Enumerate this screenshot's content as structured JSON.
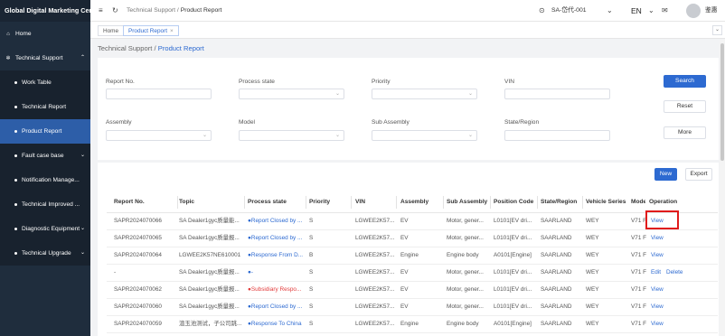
{
  "app": {
    "title": "Global Digital Marketing Center"
  },
  "sidebar": {
    "items": [
      {
        "label": "Home",
        "icon": "home-icon",
        "type": "top",
        "arrow": ""
      },
      {
        "label": "Technical Support",
        "icon": "gear-icon",
        "type": "top",
        "arrow": "⌃"
      },
      {
        "label": "Work Table",
        "type": "sub"
      },
      {
        "label": "Technical Report",
        "type": "sub"
      },
      {
        "label": "Product Report",
        "type": "sub",
        "active": true
      },
      {
        "label": "Fault case base",
        "type": "sub",
        "arrow": "⌄"
      },
      {
        "label": "Notification Manage...",
        "type": "sub"
      },
      {
        "label": "Technical Improved ...",
        "type": "sub"
      },
      {
        "label": "Diagnostic Equipment",
        "type": "sub",
        "arrow": "⌄"
      },
      {
        "label": "Technical Upgrade",
        "type": "sub",
        "arrow": "⌄"
      }
    ]
  },
  "topbar": {
    "breadcrumb": [
      "Technical Support",
      "Product Report"
    ],
    "org": "SA-岱代-001",
    "lang": "EN",
    "user": "鉴惠"
  },
  "tabs": [
    {
      "label": "Home",
      "active": false
    },
    {
      "label": "Product Report",
      "active": true
    }
  ],
  "page_breadcrumb": {
    "parent": "Technical Support",
    "sep": "/",
    "current": "Product Report"
  },
  "filters": {
    "fields": [
      {
        "label": "Report No.",
        "type": "input",
        "value": ""
      },
      {
        "label": "Process state",
        "type": "select",
        "value": ""
      },
      {
        "label": "Priority",
        "type": "select",
        "value": ""
      },
      {
        "label": "VIN",
        "type": "input",
        "value": ""
      },
      {
        "label": "Assembly",
        "type": "select",
        "value": ""
      },
      {
        "label": "Model",
        "type": "select",
        "value": ""
      },
      {
        "label": "Sub Assembly",
        "type": "select",
        "value": ""
      },
      {
        "label": "State/Region",
        "type": "input",
        "value": ""
      }
    ],
    "buttons": {
      "search": "Search",
      "reset": "Reset",
      "more": "More"
    }
  },
  "table": {
    "actions": {
      "new": "New",
      "export": "Export"
    },
    "columns": [
      "Report No.",
      "Topic",
      "Process state",
      "Priority",
      "VIN",
      "Assembly",
      "Sub Assembly",
      "Position Code",
      "State/Region",
      "Vehicle Series",
      "Mode",
      "Operation"
    ],
    "rows": [
      {
        "report_no": "SAPR2024070066",
        "topic": "SA Dealer1gyc质量能...",
        "state": "●Report Closed by ...",
        "state_color": "#2d6ad1",
        "priority": "S",
        "vin": "LGWEE2K57...",
        "assembly": "EV",
        "sub_assembly": "Motor, gener...",
        "position": "L0101[EV dri...",
        "region": "SAARLAND",
        "series": "WEY",
        "mode": "V71 F",
        "ops": [
          "View"
        ]
      },
      {
        "report_no": "SAPR2024070065",
        "topic": "SA Dealer1gyc质量报...",
        "state": "●Report Closed by ...",
        "state_color": "#2d6ad1",
        "priority": "S",
        "vin": "LGWEE2K57...",
        "assembly": "EV",
        "sub_assembly": "Motor, gener...",
        "position": "L0101[EV dri...",
        "region": "SAARLAND",
        "series": "WEY",
        "mode": "V71 F",
        "ops": [
          "View"
        ]
      },
      {
        "report_no": "SAPR2024070064",
        "topic": "LGWEE2K57NE610001",
        "state": "●Response From D...",
        "state_color": "#2d6ad1",
        "priority": "B",
        "vin": "LGWEE2K57...",
        "assembly": "Engine",
        "sub_assembly": "Engine body",
        "position": "A0101[Engine]",
        "region": "SAARLAND",
        "series": "WEY",
        "mode": "V71 F",
        "ops": [
          "View"
        ]
      },
      {
        "report_no": "-",
        "topic": "SA Dealer1gyc质量报...",
        "state": "●-",
        "state_color": "#2d6ad1",
        "priority": "S",
        "vin": "LGWEE2K57...",
        "assembly": "EV",
        "sub_assembly": "Motor, gener...",
        "position": "L0101[EV dri...",
        "region": "SAARLAND",
        "series": "WEY",
        "mode": "V71 F",
        "ops": [
          "Edit",
          "Delete"
        ]
      },
      {
        "report_no": "SAPR2024070062",
        "topic": "SA Dealer1gyc质量报...",
        "state": "●Subsidiary Respo...",
        "state_color": "#e23b3b",
        "priority": "S",
        "vin": "LGWEE2K57...",
        "assembly": "EV",
        "sub_assembly": "Motor, gener...",
        "position": "L0101[EV dri...",
        "region": "SAARLAND",
        "series": "WEY",
        "mode": "V71 F",
        "ops": [
          "View"
        ]
      },
      {
        "report_no": "SAPR2024070060",
        "topic": "SA Dealer1gyc质量报...",
        "state": "●Report Closed by ...",
        "state_color": "#2d6ad1",
        "priority": "S",
        "vin": "LGWEE2K57...",
        "assembly": "EV",
        "sub_assembly": "Motor, gener...",
        "position": "L0101[EV dri...",
        "region": "SAARLAND",
        "series": "WEY",
        "mode": "V71 F",
        "ops": [
          "View"
        ]
      },
      {
        "report_no": "SAPR2024070059",
        "topic": "渲玉池测试，子公司跳...",
        "state": "●Response To China",
        "state_color": "#2d6ad1",
        "priority": "S",
        "vin": "LGWEE2K57...",
        "assembly": "Engine",
        "sub_assembly": "Engine body",
        "position": "A0101[Engine]",
        "region": "SAARLAND",
        "series": "WEY",
        "mode": "V71 F",
        "ops": [
          "View"
        ]
      }
    ]
  },
  "colors": {
    "sidebar_bg": "#1f2d3d",
    "active_nav": "#2d5ea8",
    "primary": "#2d6ad1",
    "alert": "#e23b3b",
    "highlight_box": "#e01b1b"
  }
}
